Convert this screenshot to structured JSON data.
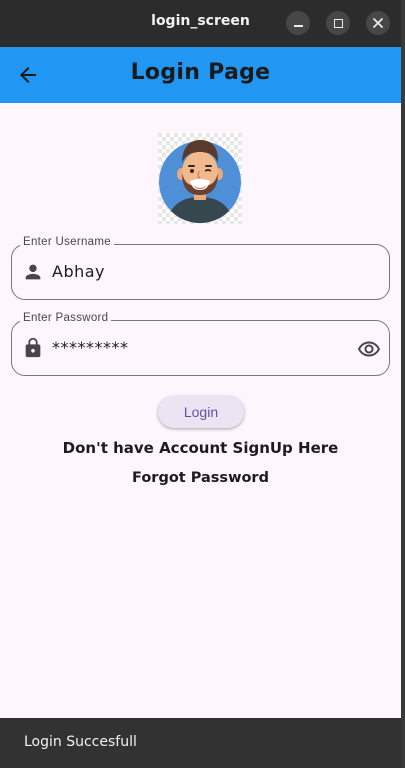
{
  "window": {
    "title": "login_screen",
    "controls": [
      "minimize-icon",
      "maximize-icon",
      "close-icon"
    ]
  },
  "appbar": {
    "back_icon": "arrow-back-icon",
    "title": "Login Page",
    "color": "#2196f3"
  },
  "avatar": {
    "icon": "avatar-illustration"
  },
  "form": {
    "username": {
      "label": "Enter Username",
      "value": "Abhay",
      "icon": "person-icon"
    },
    "password": {
      "label": "Enter Password",
      "value": "*********",
      "icon": "lock-icon",
      "toggle_icon": "eye-icon"
    },
    "login_label": "Login",
    "signup_text": "Don't have Account SignUp Here",
    "forgot_text": "Forgot Password"
  },
  "snackbar": {
    "message": "Login Succesfull"
  }
}
